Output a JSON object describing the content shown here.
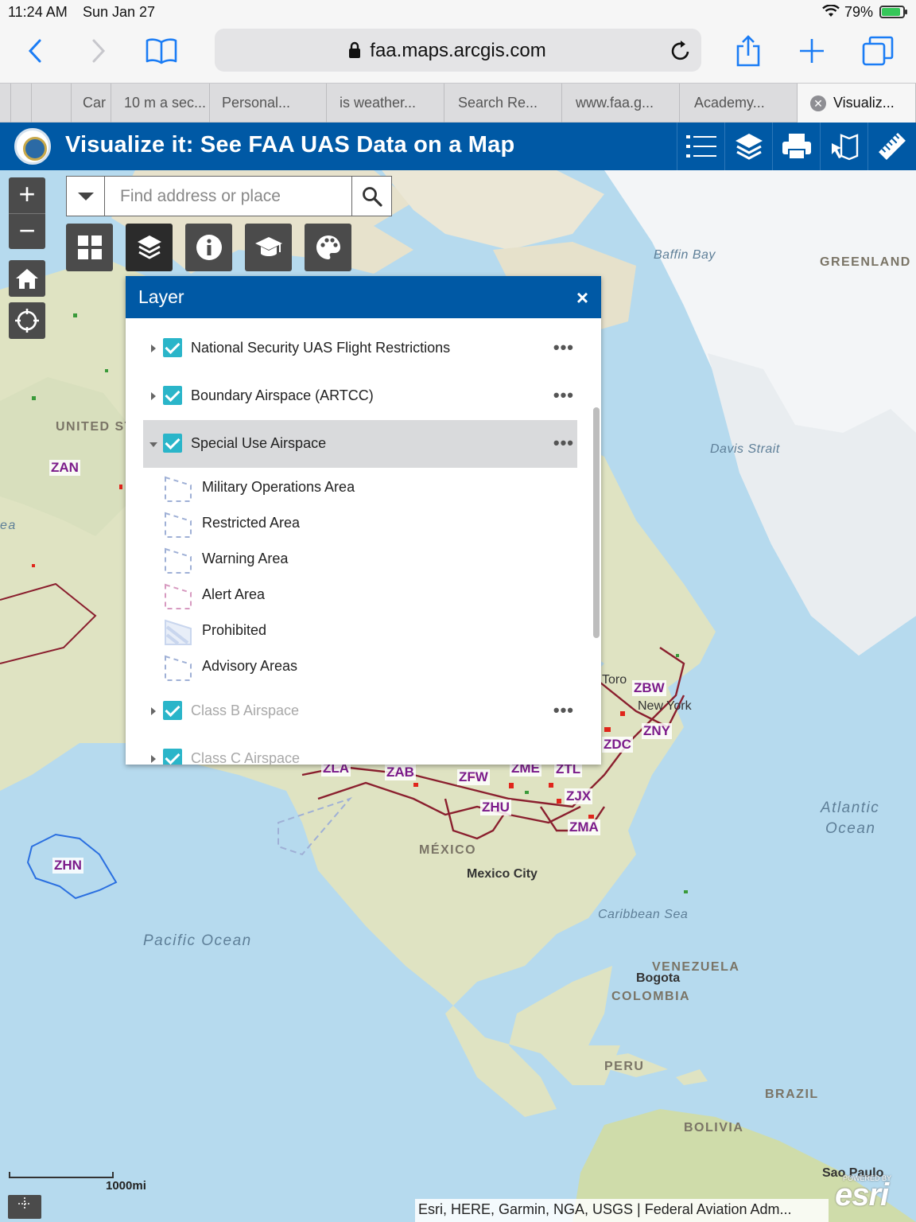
{
  "status": {
    "time": "11:24 AM",
    "date": "Sun Jan 27",
    "battery": "79%"
  },
  "browser": {
    "url": "faa.maps.arcgis.com",
    "tabs": [
      {
        "label": "Car"
      },
      {
        "label": "10 m a sec..."
      },
      {
        "label": "Personal..."
      },
      {
        "label": "is weather..."
      },
      {
        "label": "Search Re..."
      },
      {
        "label": "www.faa.g..."
      },
      {
        "label": "Academy..."
      },
      {
        "label": "Visualiz..."
      }
    ]
  },
  "app": {
    "title": "Visualize it: See FAA UAS Data on a Map"
  },
  "search": {
    "placeholder": "Find address or place"
  },
  "panel": {
    "title": "Layer",
    "close": "×",
    "layers": [
      {
        "name": "National Security UAS Flight Restrictions"
      },
      {
        "name": "Boundary Airspace (ARTCC)"
      },
      {
        "name": "Special Use Airspace"
      },
      {
        "name": "Class B Airspace"
      },
      {
        "name": "Class C Airspace"
      }
    ],
    "legend": [
      {
        "label": "Military Operations Area",
        "color": "#9fb0d6"
      },
      {
        "label": "Restricted Area",
        "color": "#9fb0d6"
      },
      {
        "label": "Warning Area",
        "color": "#9fb0d6"
      },
      {
        "label": "Alert Area",
        "color": "#d79ac0"
      },
      {
        "label": "Prohibited",
        "color": "#c9d6ee"
      },
      {
        "label": "Advisory Areas",
        "color": "#9fb0d6"
      }
    ],
    "more": "•••"
  },
  "map": {
    "labels": {
      "baffin": "Baffin Bay",
      "greenland": "GREENLAND",
      "davis": "Davis Strait",
      "us": "UNITED ST",
      "ea": "ea",
      "toronto": "Toro",
      "newyork": "New York",
      "atlantic1": "Atlantic",
      "atlantic2": "Ocean",
      "mexico": "MÉXICO",
      "mexicocity": "Mexico City",
      "caribbean": "Caribbean Sea",
      "pacific": "Pacific Ocean",
      "venezuela": "VENEZUELA",
      "bogota": "Bogota",
      "colombia": "COLOMBIA",
      "peru": "PERU",
      "brazil": "BRAZIL",
      "bolivia": "BOLIVIA",
      "saopaulo": "Sao Paulo"
    },
    "artcc": {
      "zan": "ZAN",
      "zhn": "ZHN",
      "zbw": "ZBW",
      "zny": "ZNY",
      "zdc": "ZDC",
      "zla": "ZLA",
      "zab": "ZAB",
      "zfw": "ZFW",
      "zme": "ZME",
      "ztl": "ZTL",
      "zjx": "ZJX",
      "zhu": "ZHU",
      "zma": "ZMA"
    },
    "scale": "1000mi",
    "attribution": "Esri, HERE, Garmin, NGA, USGS | Federal Aviation Adm...",
    "esri": "esri",
    "esri_powered": "POWERED BY"
  }
}
